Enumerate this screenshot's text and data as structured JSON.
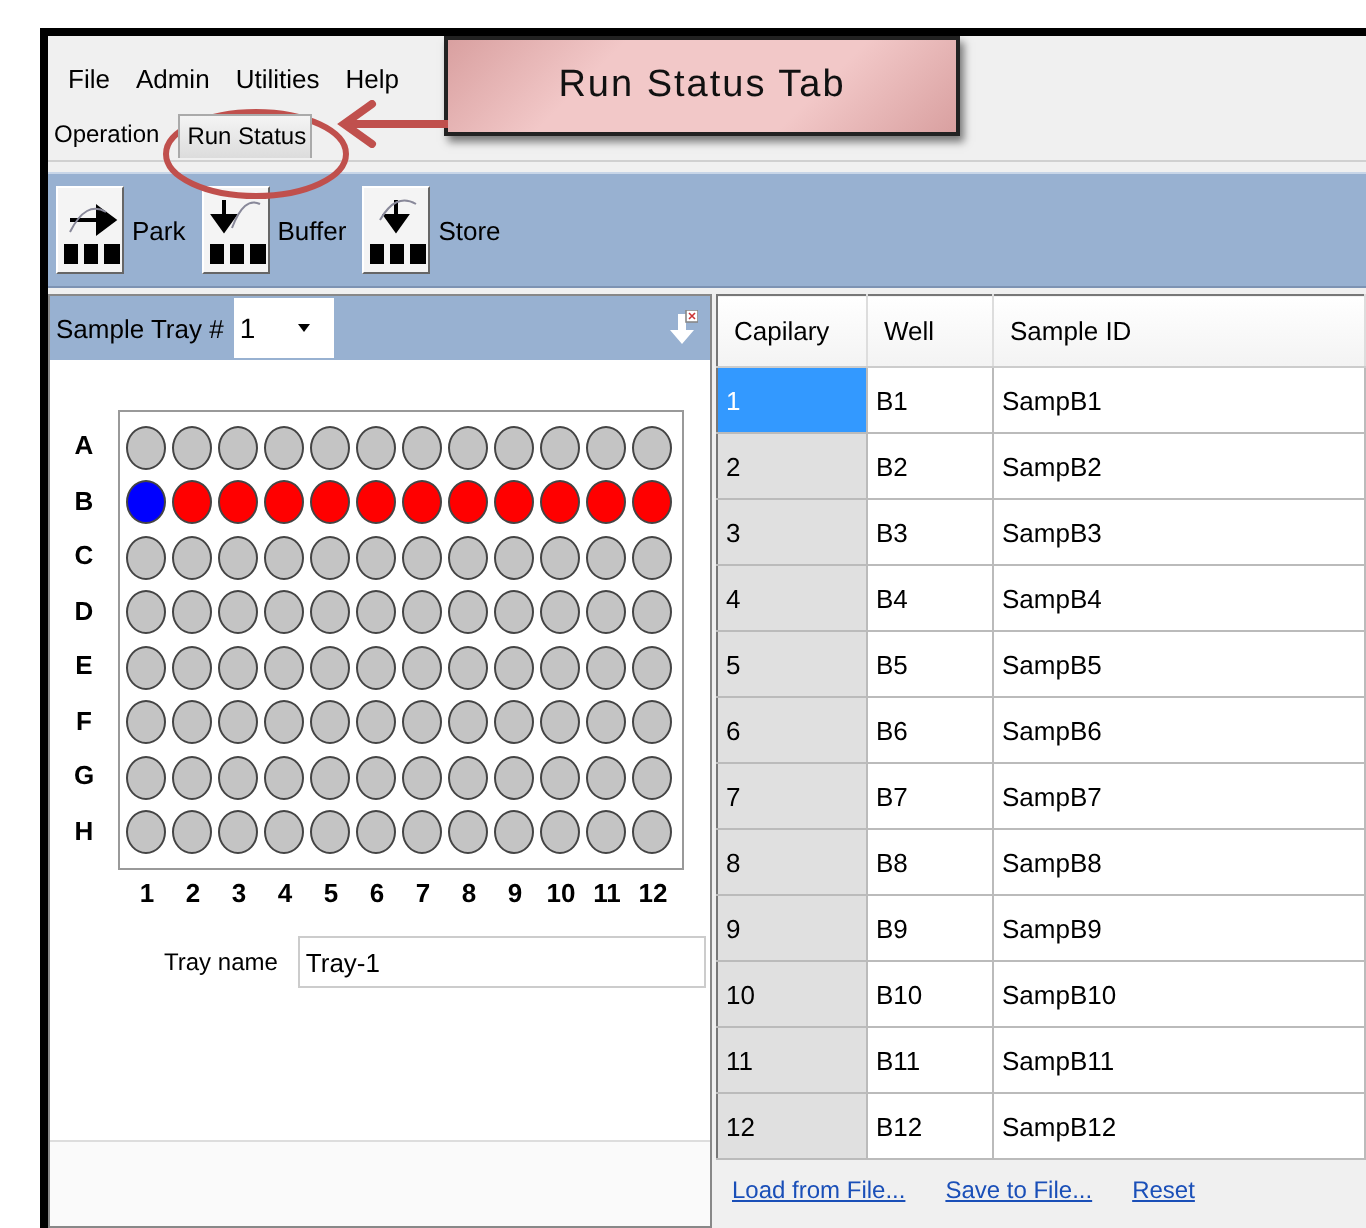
{
  "menu": [
    "File",
    "Admin",
    "Utilities",
    "Help"
  ],
  "tabs": [
    {
      "label": "Operation",
      "selected": true
    },
    {
      "label": "Run Status",
      "selected": false
    }
  ],
  "toolbar": [
    {
      "label": "Park",
      "kind": "park"
    },
    {
      "label": "Buffer",
      "kind": "buffer"
    },
    {
      "label": "Store",
      "kind": "store"
    }
  ],
  "tray_panel": {
    "label": "Sample Tray #",
    "tray_select": "1",
    "rows": [
      {
        "label": "A",
        "wells": [
          {
            "color": "#c4c4c4"
          },
          {
            "color": "#c4c4c4"
          },
          {
            "color": "#c4c4c4"
          },
          {
            "color": "#c4c4c4"
          },
          {
            "color": "#c4c4c4"
          },
          {
            "color": "#c4c4c4"
          },
          {
            "color": "#c4c4c4"
          },
          {
            "color": "#c4c4c4"
          },
          {
            "color": "#c4c4c4"
          },
          {
            "color": "#c4c4c4"
          },
          {
            "color": "#c4c4c4"
          },
          {
            "color": "#c4c4c4"
          }
        ]
      },
      {
        "label": "B",
        "wells": [
          {
            "color": "#0000ff"
          },
          {
            "color": "#ff0000"
          },
          {
            "color": "#ff0000"
          },
          {
            "color": "#ff0000"
          },
          {
            "color": "#ff0000"
          },
          {
            "color": "#ff0000"
          },
          {
            "color": "#ff0000"
          },
          {
            "color": "#ff0000"
          },
          {
            "color": "#ff0000"
          },
          {
            "color": "#ff0000"
          },
          {
            "color": "#ff0000"
          },
          {
            "color": "#ff0000"
          }
        ]
      },
      {
        "label": "C",
        "wells": [
          {
            "color": "#c4c4c4"
          },
          {
            "color": "#c4c4c4"
          },
          {
            "color": "#c4c4c4"
          },
          {
            "color": "#c4c4c4"
          },
          {
            "color": "#c4c4c4"
          },
          {
            "color": "#c4c4c4"
          },
          {
            "color": "#c4c4c4"
          },
          {
            "color": "#c4c4c4"
          },
          {
            "color": "#c4c4c4"
          },
          {
            "color": "#c4c4c4"
          },
          {
            "color": "#c4c4c4"
          },
          {
            "color": "#c4c4c4"
          }
        ]
      },
      {
        "label": "D",
        "wells": [
          {
            "color": "#c4c4c4"
          },
          {
            "color": "#c4c4c4"
          },
          {
            "color": "#c4c4c4"
          },
          {
            "color": "#c4c4c4"
          },
          {
            "color": "#c4c4c4"
          },
          {
            "color": "#c4c4c4"
          },
          {
            "color": "#c4c4c4"
          },
          {
            "color": "#c4c4c4"
          },
          {
            "color": "#c4c4c4"
          },
          {
            "color": "#c4c4c4"
          },
          {
            "color": "#c4c4c4"
          },
          {
            "color": "#c4c4c4"
          }
        ]
      },
      {
        "label": "E",
        "wells": [
          {
            "color": "#c4c4c4"
          },
          {
            "color": "#c4c4c4"
          },
          {
            "color": "#c4c4c4"
          },
          {
            "color": "#c4c4c4"
          },
          {
            "color": "#c4c4c4"
          },
          {
            "color": "#c4c4c4"
          },
          {
            "color": "#c4c4c4"
          },
          {
            "color": "#c4c4c4"
          },
          {
            "color": "#c4c4c4"
          },
          {
            "color": "#c4c4c4"
          },
          {
            "color": "#c4c4c4"
          },
          {
            "color": "#c4c4c4"
          }
        ]
      },
      {
        "label": "F",
        "wells": [
          {
            "color": "#c4c4c4"
          },
          {
            "color": "#c4c4c4"
          },
          {
            "color": "#c4c4c4"
          },
          {
            "color": "#c4c4c4"
          },
          {
            "color": "#c4c4c4"
          },
          {
            "color": "#c4c4c4"
          },
          {
            "color": "#c4c4c4"
          },
          {
            "color": "#c4c4c4"
          },
          {
            "color": "#c4c4c4"
          },
          {
            "color": "#c4c4c4"
          },
          {
            "color": "#c4c4c4"
          },
          {
            "color": "#c4c4c4"
          }
        ]
      },
      {
        "label": "G",
        "wells": [
          {
            "color": "#c4c4c4"
          },
          {
            "color": "#c4c4c4"
          },
          {
            "color": "#c4c4c4"
          },
          {
            "color": "#c4c4c4"
          },
          {
            "color": "#c4c4c4"
          },
          {
            "color": "#c4c4c4"
          },
          {
            "color": "#c4c4c4"
          },
          {
            "color": "#c4c4c4"
          },
          {
            "color": "#c4c4c4"
          },
          {
            "color": "#c4c4c4"
          },
          {
            "color": "#c4c4c4"
          },
          {
            "color": "#c4c4c4"
          }
        ]
      },
      {
        "label": "H",
        "wells": [
          {
            "color": "#c4c4c4"
          },
          {
            "color": "#c4c4c4"
          },
          {
            "color": "#c4c4c4"
          },
          {
            "color": "#c4c4c4"
          },
          {
            "color": "#c4c4c4"
          },
          {
            "color": "#c4c4c4"
          },
          {
            "color": "#c4c4c4"
          },
          {
            "color": "#c4c4c4"
          },
          {
            "color": "#c4c4c4"
          },
          {
            "color": "#c4c4c4"
          },
          {
            "color": "#c4c4c4"
          },
          {
            "color": "#c4c4c4"
          }
        ]
      }
    ],
    "column_labels": [
      "1",
      "2",
      "3",
      "4",
      "5",
      "6",
      "7",
      "8",
      "9",
      "10",
      "11",
      "12"
    ],
    "tray_name_label": "Tray name",
    "tray_name": "Tray-1"
  },
  "table": {
    "columns": [
      "Capilary",
      "Well",
      "Sample ID"
    ],
    "rows": [
      {
        "cells": [
          "1",
          "B1",
          "SampB1"
        ],
        "selected": true
      },
      {
        "cells": [
          "2",
          "B2",
          "SampB2"
        ],
        "selected": false
      },
      {
        "cells": [
          "3",
          "B3",
          "SampB3"
        ],
        "selected": false
      },
      {
        "cells": [
          "4",
          "B4",
          "SampB4"
        ],
        "selected": false
      },
      {
        "cells": [
          "5",
          "B5",
          "SampB5"
        ],
        "selected": false
      },
      {
        "cells": [
          "6",
          "B6",
          "SampB6"
        ],
        "selected": false
      },
      {
        "cells": [
          "7",
          "B7",
          "SampB7"
        ],
        "selected": false
      },
      {
        "cells": [
          "8",
          "B8",
          "SampB8"
        ],
        "selected": false
      },
      {
        "cells": [
          "9",
          "B9",
          "SampB9"
        ],
        "selected": false
      },
      {
        "cells": [
          "10",
          "B10",
          "SampB10"
        ],
        "selected": false
      },
      {
        "cells": [
          "11",
          "B11",
          "SampB11"
        ],
        "selected": false
      },
      {
        "cells": [
          "12",
          "B12",
          "SampB12"
        ],
        "selected": false
      }
    ]
  },
  "links": [
    "Load from File...",
    "Save to File...",
    "Reset"
  ],
  "annotation": {
    "callout": "Run Status Tab"
  }
}
